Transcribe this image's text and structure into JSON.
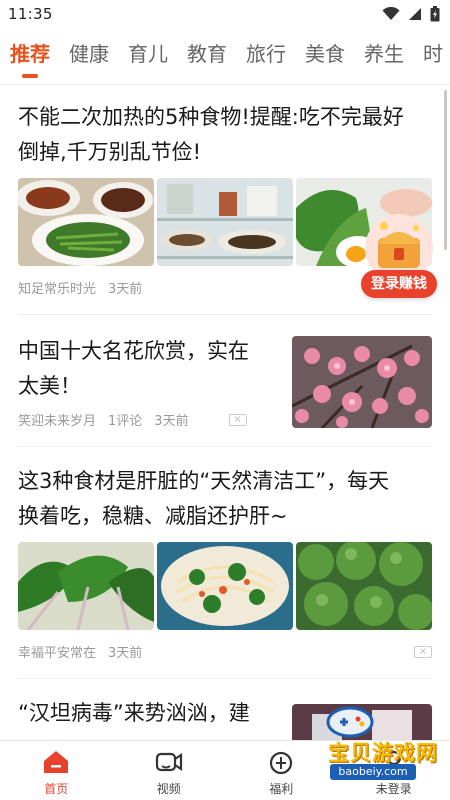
{
  "status": {
    "time": "11:35"
  },
  "tabs": [
    "推荐",
    "健康",
    "育儿",
    "教育",
    "旅行",
    "美食",
    "养生",
    "时"
  ],
  "articles": [
    {
      "title_line1": "不能二次加热的5种食物!提醒:吃不完最好",
      "title_line2": "倒掉,千万别乱节俭!",
      "source": "知足常乐时光",
      "time": "3天前"
    },
    {
      "title_line1": "中国十大名花欣赏，实在",
      "title_line2": "太美！",
      "source": "笑迎未来岁月",
      "comments": "1评论",
      "time": "3天前"
    },
    {
      "title_line1": "这3种食材是肝脏的“天然清洁工”，每天",
      "title_line2": "换着吃，稳糖、减脂还护肝~",
      "source": "幸福平安常在",
      "time": "3天前"
    },
    {
      "title_line1": "“汉坦病毒”来势汹汹，建"
    }
  ],
  "login_float": {
    "label": "登录赚钱"
  },
  "bottom_nav": [
    {
      "label": "首页",
      "icon": "home-icon"
    },
    {
      "label": "视频",
      "icon": "video-icon"
    },
    {
      "label": "福利",
      "icon": "gift-icon"
    },
    {
      "label": "未登录",
      "icon": "user-icon"
    }
  ],
  "watermark": {
    "text": "宝贝游戏网",
    "sub": "baobeiy.com"
  },
  "colors": {
    "accent": "#e8521f",
    "login_button": "#e8412c",
    "meta_text": "#999999"
  }
}
